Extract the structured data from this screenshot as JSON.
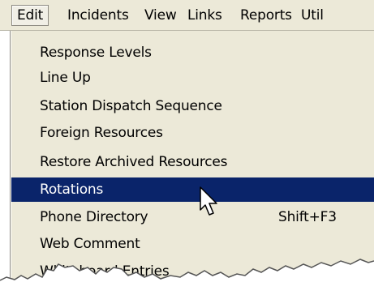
{
  "menubar": {
    "items": [
      {
        "label": "Edit",
        "active": true
      },
      {
        "label": "Incidents"
      },
      {
        "label": "View"
      },
      {
        "label": "Links"
      },
      {
        "label": "Reports"
      },
      {
        "label": "Util"
      }
    ]
  },
  "dropdown": {
    "items": [
      {
        "label": "Response Levels"
      },
      {
        "label": "Line Up"
      },
      {
        "label": "Station Dispatch Sequence"
      },
      {
        "label": "Foreign Resources"
      },
      {
        "label": "Restore Archived Resources"
      },
      {
        "label": "Rotations",
        "selected": true
      },
      {
        "label": "Phone Directory",
        "shortcut": "Shift+F3"
      },
      {
        "label": "Web Comment"
      },
      {
        "label": "Whiteboard Entries"
      }
    ]
  },
  "colors": {
    "menu_background": "#ece9d8",
    "selection": "#0a246a",
    "selection_text": "#ffffff"
  },
  "icons": {
    "cursor": "arrow-cursor-icon"
  }
}
